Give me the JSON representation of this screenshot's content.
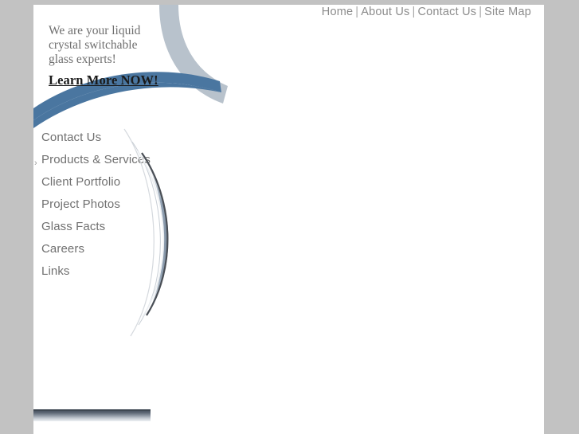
{
  "colors": {
    "page_background": "#c2c2c2",
    "panel_background": "#ffffff",
    "swoosh_blue": "#4a76a0",
    "arc_gray": "#b8c2cc",
    "nav_text": "#8c8c8c",
    "sidebar_text": "#707070",
    "hero_text": "#6e6e6e",
    "link_text": "#1a1a1a"
  },
  "topnav": {
    "separator": "|",
    "items": [
      {
        "label": "Home"
      },
      {
        "label": "About Us"
      },
      {
        "label": "Contact Us"
      },
      {
        "label": "Site Map"
      }
    ]
  },
  "hero": {
    "headline_line1": "We are your liquid",
    "headline_line2": "crystal switchable",
    "headline_line3": "glass experts!",
    "cta_label": "Learn More NOW!"
  },
  "sidebar": {
    "items": [
      {
        "label": "Contact Us",
        "marker": ""
      },
      {
        "label": "Products & Services",
        "marker": "›"
      },
      {
        "label": "Client Portfolio",
        "marker": ""
      },
      {
        "label": "Project Photos",
        "marker": ""
      },
      {
        "label": "Glass Facts",
        "marker": ""
      },
      {
        "label": "Careers",
        "marker": ""
      },
      {
        "label": "Links",
        "marker": ""
      }
    ]
  },
  "decor": {
    "swoosh_name": "blue-swoosh",
    "arc_name": "gray-arc",
    "lens_name": "lens-graphic",
    "bottom_bar_name": "gradient-bar"
  }
}
